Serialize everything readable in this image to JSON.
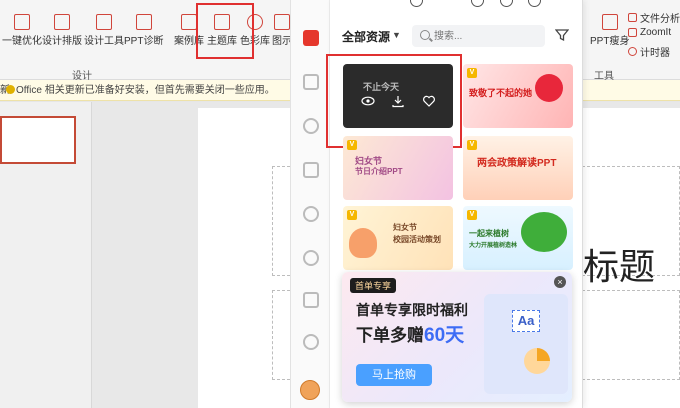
{
  "ribbon": {
    "buttons": [
      {
        "label": "一键优化"
      },
      {
        "label": "设计排版"
      },
      {
        "label": "设计工具"
      },
      {
        "label": "PPT诊断"
      },
      {
        "label": "案例库"
      },
      {
        "label": "主题库"
      },
      {
        "label": "色彩库"
      },
      {
        "label": "图示"
      },
      {
        "label": "PPT瘦身"
      }
    ],
    "group_design": "设计",
    "group_tools": "工具",
    "side_items": [
      {
        "label": "文件分析"
      },
      {
        "label": "ZoomIt"
      },
      {
        "label": "计时器"
      }
    ]
  },
  "notify": {
    "prefix": "新",
    "message": "Office 相关更新已准备好安装，但首先需要关闭一些应用。"
  },
  "slide": {
    "title": "标题"
  },
  "panel": {
    "filter_label": "全部资源",
    "search_placeholder": "搜索...",
    "cards": [
      {
        "title": "不止今天"
      },
      {
        "title": "致敬了不起的她"
      },
      {
        "title": "妇女节",
        "subtitle": "节日介绍PPT"
      },
      {
        "title": "两会政策解读PPT"
      },
      {
        "title": "妇女节",
        "subtitle": "校园活动策划"
      },
      {
        "title": "一起来植树",
        "subtitle": "大力开展植树造林"
      }
    ]
  },
  "ad": {
    "tag": "首单专享",
    "headline": "首单专享限时福利",
    "offer_prefix": "下单多赠",
    "offer_value": "60天",
    "button": "马上抢购",
    "art_text": "Aa",
    "close": "×"
  },
  "colors": {
    "accent": "#d0453b",
    "highlight": "#e03030",
    "ad_button": "#4aa0ff"
  }
}
